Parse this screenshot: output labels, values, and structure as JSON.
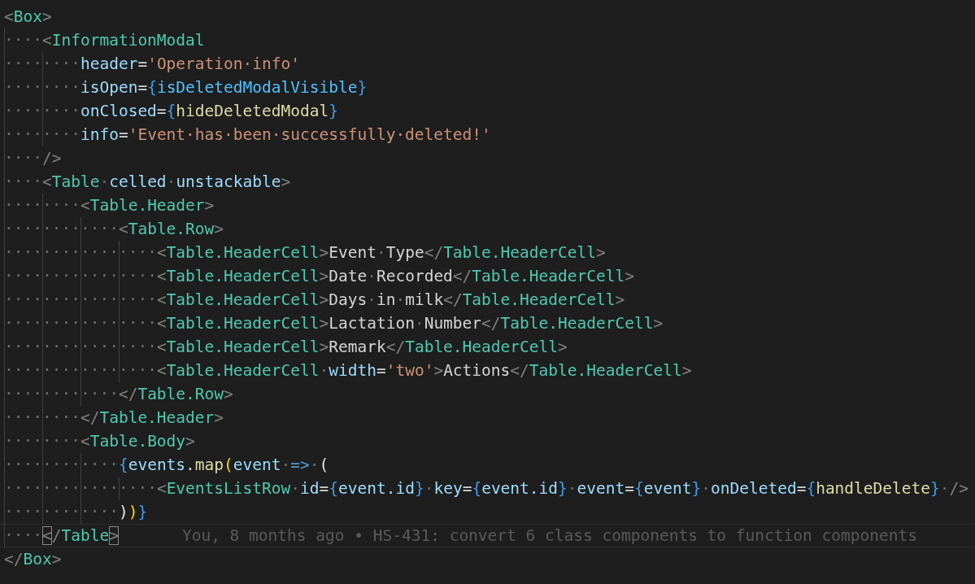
{
  "editor": {
    "lines": [
      {
        "tokens": [
          {
            "kind": "p",
            "text": "<"
          },
          {
            "kind": "tag",
            "text": "Box"
          },
          {
            "kind": "p",
            "text": ">"
          }
        ]
      },
      {
        "tokens": [
          {
            "kind": "ind",
            "text": "····"
          },
          {
            "kind": "p",
            "text": "<"
          },
          {
            "kind": "tag",
            "text": "InformationModal"
          }
        ]
      },
      {
        "tokens": [
          {
            "kind": "ind",
            "text": "········"
          },
          {
            "kind": "attr",
            "text": "header"
          },
          {
            "kind": "txt",
            "text": "="
          },
          {
            "kind": "str",
            "text": "'Operation·info'"
          }
        ]
      },
      {
        "tokens": [
          {
            "kind": "ind",
            "text": "········"
          },
          {
            "kind": "attr",
            "text": "isOpen"
          },
          {
            "kind": "txt",
            "text": "="
          },
          {
            "kind": "br",
            "text": "{"
          },
          {
            "kind": "var",
            "text": "isDeletedModalVisible"
          },
          {
            "kind": "br",
            "text": "}"
          }
        ]
      },
      {
        "tokens": [
          {
            "kind": "ind",
            "text": "········"
          },
          {
            "kind": "attr",
            "text": "onClosed"
          },
          {
            "kind": "txt",
            "text": "="
          },
          {
            "kind": "br",
            "text": "{"
          },
          {
            "kind": "fn",
            "text": "hideDeletedModal"
          },
          {
            "kind": "br",
            "text": "}"
          }
        ]
      },
      {
        "tokens": [
          {
            "kind": "ind",
            "text": "········"
          },
          {
            "kind": "attr",
            "text": "info"
          },
          {
            "kind": "txt",
            "text": "="
          },
          {
            "kind": "str",
            "text": "'Event·has·been·successfully·deleted!'"
          }
        ]
      },
      {
        "tokens": [
          {
            "kind": "ind",
            "text": "····"
          },
          {
            "kind": "p",
            "text": "/>"
          }
        ]
      },
      {
        "tokens": [
          {
            "kind": "ind",
            "text": "····"
          },
          {
            "kind": "p",
            "text": "<"
          },
          {
            "kind": "tag",
            "text": "Table"
          },
          {
            "kind": "ws",
            "text": "·"
          },
          {
            "kind": "attr",
            "text": "celled"
          },
          {
            "kind": "ws",
            "text": "·"
          },
          {
            "kind": "attr",
            "text": "unstackable"
          },
          {
            "kind": "p",
            "text": ">"
          }
        ]
      },
      {
        "tokens": [
          {
            "kind": "ind",
            "text": "········"
          },
          {
            "kind": "p",
            "text": "<"
          },
          {
            "kind": "tag",
            "text": "Table.Header"
          },
          {
            "kind": "p",
            "text": ">"
          }
        ]
      },
      {
        "tokens": [
          {
            "kind": "ind",
            "text": "············"
          },
          {
            "kind": "p",
            "text": "<"
          },
          {
            "kind": "tag",
            "text": "Table.Row"
          },
          {
            "kind": "p",
            "text": ">"
          }
        ]
      },
      {
        "tokens": [
          {
            "kind": "ind",
            "text": "················"
          },
          {
            "kind": "p",
            "text": "<"
          },
          {
            "kind": "tag",
            "text": "Table.HeaderCell"
          },
          {
            "kind": "p",
            "text": ">"
          },
          {
            "kind": "txt",
            "text": "Event"
          },
          {
            "kind": "ws",
            "text": "·"
          },
          {
            "kind": "txt",
            "text": "Type"
          },
          {
            "kind": "p",
            "text": "</"
          },
          {
            "kind": "tag",
            "text": "Table.HeaderCell"
          },
          {
            "kind": "p",
            "text": ">"
          }
        ]
      },
      {
        "tokens": [
          {
            "kind": "ind",
            "text": "················"
          },
          {
            "kind": "p",
            "text": "<"
          },
          {
            "kind": "tag",
            "text": "Table.HeaderCell"
          },
          {
            "kind": "p",
            "text": ">"
          },
          {
            "kind": "txt",
            "text": "Date"
          },
          {
            "kind": "ws",
            "text": "·"
          },
          {
            "kind": "txt",
            "text": "Recorded"
          },
          {
            "kind": "p",
            "text": "</"
          },
          {
            "kind": "tag",
            "text": "Table.HeaderCell"
          },
          {
            "kind": "p",
            "text": ">"
          }
        ]
      },
      {
        "tokens": [
          {
            "kind": "ind",
            "text": "················"
          },
          {
            "kind": "p",
            "text": "<"
          },
          {
            "kind": "tag",
            "text": "Table.HeaderCell"
          },
          {
            "kind": "p",
            "text": ">"
          },
          {
            "kind": "txt",
            "text": "Days"
          },
          {
            "kind": "ws",
            "text": "·"
          },
          {
            "kind": "txt",
            "text": "in"
          },
          {
            "kind": "ws",
            "text": "·"
          },
          {
            "kind": "txt",
            "text": "milk"
          },
          {
            "kind": "p",
            "text": "</"
          },
          {
            "kind": "tag",
            "text": "Table.HeaderCell"
          },
          {
            "kind": "p",
            "text": ">"
          }
        ]
      },
      {
        "tokens": [
          {
            "kind": "ind",
            "text": "················"
          },
          {
            "kind": "p",
            "text": "<"
          },
          {
            "kind": "tag",
            "text": "Table.HeaderCell"
          },
          {
            "kind": "p",
            "text": ">"
          },
          {
            "kind": "txt",
            "text": "Lactation"
          },
          {
            "kind": "ws",
            "text": "·"
          },
          {
            "kind": "txt",
            "text": "Number"
          },
          {
            "kind": "p",
            "text": "</"
          },
          {
            "kind": "tag",
            "text": "Table.HeaderCell"
          },
          {
            "kind": "p",
            "text": ">"
          }
        ]
      },
      {
        "tokens": [
          {
            "kind": "ind",
            "text": "················"
          },
          {
            "kind": "p",
            "text": "<"
          },
          {
            "kind": "tag",
            "text": "Table.HeaderCell"
          },
          {
            "kind": "p",
            "text": ">"
          },
          {
            "kind": "txt",
            "text": "Remark"
          },
          {
            "kind": "p",
            "text": "</"
          },
          {
            "kind": "tag",
            "text": "Table.HeaderCell"
          },
          {
            "kind": "p",
            "text": ">"
          }
        ]
      },
      {
        "tokens": [
          {
            "kind": "ind",
            "text": "················"
          },
          {
            "kind": "p",
            "text": "<"
          },
          {
            "kind": "tag",
            "text": "Table.HeaderCell"
          },
          {
            "kind": "ws",
            "text": "·"
          },
          {
            "kind": "attr",
            "text": "width"
          },
          {
            "kind": "txt",
            "text": "="
          },
          {
            "kind": "str",
            "text": "'two'"
          },
          {
            "kind": "p",
            "text": ">"
          },
          {
            "kind": "txt",
            "text": "Actions"
          },
          {
            "kind": "p",
            "text": "</"
          },
          {
            "kind": "tag",
            "text": "Table.HeaderCell"
          },
          {
            "kind": "p",
            "text": ">"
          }
        ]
      },
      {
        "tokens": [
          {
            "kind": "ind",
            "text": "············"
          },
          {
            "kind": "p",
            "text": "</"
          },
          {
            "kind": "tag",
            "text": "Table.Row"
          },
          {
            "kind": "p",
            "text": ">"
          }
        ]
      },
      {
        "tokens": [
          {
            "kind": "ind",
            "text": "········"
          },
          {
            "kind": "p",
            "text": "</"
          },
          {
            "kind": "tag",
            "text": "Table.Header"
          },
          {
            "kind": "p",
            "text": ">"
          }
        ]
      },
      {
        "tokens": [
          {
            "kind": "ind",
            "text": "········"
          },
          {
            "kind": "p",
            "text": "<"
          },
          {
            "kind": "tag",
            "text": "Table.Body"
          },
          {
            "kind": "p",
            "text": ">"
          }
        ]
      },
      {
        "tokens": [
          {
            "kind": "ind",
            "text": "············"
          },
          {
            "kind": "br",
            "text": "{"
          },
          {
            "kind": "attr",
            "text": "events"
          },
          {
            "kind": "txt",
            "text": "."
          },
          {
            "kind": "fn",
            "text": "map"
          },
          {
            "kind": "gold",
            "text": "("
          },
          {
            "kind": "attr",
            "text": "event"
          },
          {
            "kind": "ws",
            "text": "·"
          },
          {
            "kind": "kw",
            "text": "=>"
          },
          {
            "kind": "ws",
            "text": "·"
          },
          {
            "kind": "pink",
            "text": "("
          }
        ]
      },
      {
        "tokens": [
          {
            "kind": "ind",
            "text": "················"
          },
          {
            "kind": "p",
            "text": "<"
          },
          {
            "kind": "tag",
            "text": "EventsListRow"
          },
          {
            "kind": "ws",
            "text": "·"
          },
          {
            "kind": "attr",
            "text": "id"
          },
          {
            "kind": "txt",
            "text": "="
          },
          {
            "kind": "br",
            "text": "{"
          },
          {
            "kind": "attr",
            "text": "event.id"
          },
          {
            "kind": "br",
            "text": "}"
          },
          {
            "kind": "ws",
            "text": "·"
          },
          {
            "kind": "attr",
            "text": "key"
          },
          {
            "kind": "txt",
            "text": "="
          },
          {
            "kind": "br",
            "text": "{"
          },
          {
            "kind": "attr",
            "text": "event.id"
          },
          {
            "kind": "br",
            "text": "}"
          },
          {
            "kind": "ws",
            "text": "·"
          },
          {
            "kind": "attr",
            "text": "event"
          },
          {
            "kind": "txt",
            "text": "="
          },
          {
            "kind": "br",
            "text": "{"
          },
          {
            "kind": "attr",
            "text": "event"
          },
          {
            "kind": "br",
            "text": "}"
          },
          {
            "kind": "ws",
            "text": "·"
          },
          {
            "kind": "attr",
            "text": "onDeleted"
          },
          {
            "kind": "txt",
            "text": "="
          },
          {
            "kind": "br",
            "text": "{"
          },
          {
            "kind": "fn",
            "text": "handleDelete"
          },
          {
            "kind": "br",
            "text": "}"
          },
          {
            "kind": "ws",
            "text": "·"
          },
          {
            "kind": "p",
            "text": "/>"
          }
        ]
      },
      {
        "tokens": [
          {
            "kind": "ind",
            "text": "············"
          },
          {
            "kind": "pink",
            "text": ")"
          },
          {
            "kind": "gold",
            "text": ")"
          },
          {
            "kind": "br",
            "text": "}"
          }
        ]
      },
      {
        "current": true,
        "blame": "You, 8 months ago • HS-431: convert 6 class components to function components",
        "tokens": [
          {
            "kind": "ind",
            "text": "····"
          },
          {
            "kind": "bm",
            "text": "<"
          },
          {
            "kind": "p",
            "text": "/"
          },
          {
            "kind": "tag",
            "text": "Table"
          },
          {
            "kind": "bm",
            "text": ">"
          }
        ]
      },
      {
        "tokens": [
          {
            "kind": "p",
            "text": "</"
          },
          {
            "kind": "tag",
            "text": "Box"
          },
          {
            "kind": "p",
            "text": ">"
          }
        ]
      }
    ]
  }
}
